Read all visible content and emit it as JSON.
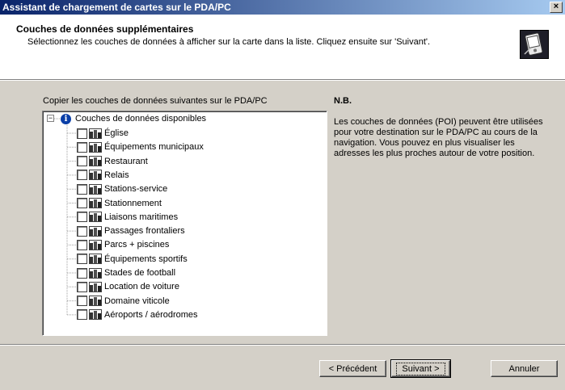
{
  "window": {
    "title": "Assistant de chargement de cartes sur le PDA/PC",
    "close_glyph": "×"
  },
  "header": {
    "title": "Couches de données supplémentaires",
    "subtitle": "Sélectionnez les couches de données à afficher sur la carte dans la liste. Cliquez ensuite sur 'Suivant'.",
    "icon": "pda-device-icon"
  },
  "left_label": "Copier les couches de données suivantes sur le PDA/PC",
  "tree": {
    "root": {
      "label": "Couches de données disponibles",
      "expander": "−",
      "info_glyph": "i",
      "icon": "info-icon"
    },
    "items": [
      {
        "label": "Église",
        "checked": false
      },
      {
        "label": "Équipements municipaux",
        "checked": false
      },
      {
        "label": "Restaurant",
        "checked": false
      },
      {
        "label": "Relais",
        "checked": false
      },
      {
        "label": "Stations-service",
        "checked": false
      },
      {
        "label": "Stationnement",
        "checked": false
      },
      {
        "label": "Liaisons maritimes",
        "checked": false
      },
      {
        "label": "Passages frontaliers",
        "checked": false
      },
      {
        "label": "Parcs + piscines",
        "checked": false
      },
      {
        "label": "Équipements sportifs",
        "checked": false
      },
      {
        "label": "Stades de football",
        "checked": false
      },
      {
        "label": "Location de voiture",
        "checked": false
      },
      {
        "label": "Domaine viticole",
        "checked": false
      },
      {
        "label": "Aéroports / aérodromes",
        "checked": false
      }
    ]
  },
  "note": {
    "title": "N.B.",
    "body": "Les couches de données (POI) peuvent être utilisées pour votre destination sur le PDA/PC au cours de la navigation. Vous pouvez en plus visualiser les adresses les plus proches autour de votre position."
  },
  "buttons": {
    "previous": "< Précédent",
    "next": "Suivant >",
    "cancel": "Annuler"
  },
  "colors": {
    "titlebar_start": "#0a246a",
    "titlebar_end": "#a6caf0",
    "face": "#d4d0c8",
    "info_blue": "#0a3fa8"
  }
}
